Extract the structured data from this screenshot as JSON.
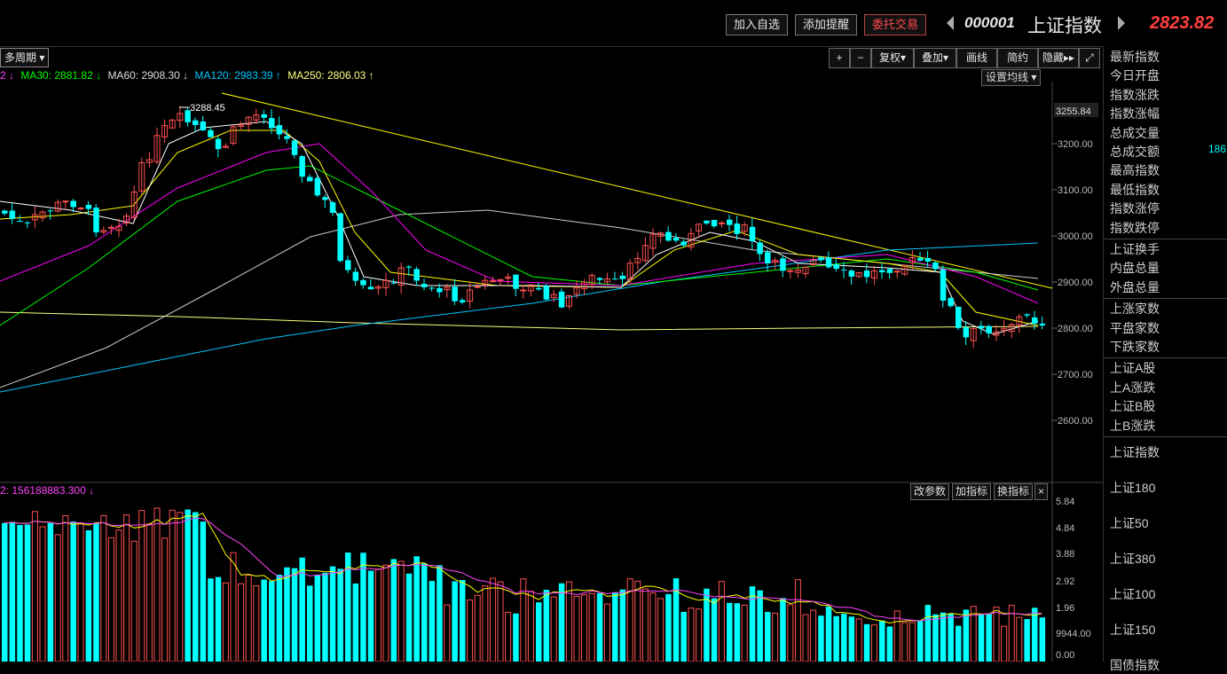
{
  "toolbar": {
    "add_watch": "加入自选",
    "add_alert": "添加提醒",
    "trade": "委托交易",
    "code": "000001",
    "name": "上证指数",
    "price": "2823.82"
  },
  "chart_toolbar": {
    "period": "多周期",
    "zoom_in": "+",
    "zoom_out": "−",
    "adjust": "复权",
    "overlay": "叠加",
    "draw": "画线",
    "brief": "简约",
    "hide": "隐藏",
    "expand": "⤢"
  },
  "ma_legend": {
    "ma_prefix": "2 ↓",
    "ma30": "MA30: 2881.82 ↓",
    "ma60": "MA60: 2908.30 ↓",
    "ma120": "MA120: 2983.39 ↑",
    "ma250": "MA250: 2806.03 ↑",
    "set_ma": "设置均线"
  },
  "price_chart": {
    "yticks": [
      "3200.00",
      "3100.00",
      "3000.00",
      "2900.00",
      "2800.00",
      "2700.00",
      "2600.00"
    ],
    "high_label": "3255.84",
    "peak_annotation": "3288.45"
  },
  "volume_panel": {
    "label": "2: 156188883.300 ↓",
    "change_params": "改参数",
    "add_indicator": "加指标",
    "switch_indicator": "换指标",
    "close": "×",
    "yticks": [
      "5.84",
      "4.84",
      "3.88",
      "2.92",
      "1.96",
      "9944.00",
      "0.00"
    ]
  },
  "right_panel": {
    "group1": [
      "最新指数",
      "今日开盘",
      "指数涨跌",
      "指数涨幅",
      "总成交量",
      "总成交额",
      "最高指数",
      "最低指数",
      "指数涨停",
      "指数跌停"
    ],
    "turnover_value": "186",
    "group2": [
      "上证换手",
      "内盘总量",
      "外盘总量"
    ],
    "group3": [
      "上涨家数",
      "平盘家数",
      "下跌家数"
    ],
    "group4": [
      "上证A股",
      "上A涨跌",
      "上证B股",
      "上B涨跌"
    ],
    "group5": [
      "上证指数",
      "上证180",
      "上证50",
      "上证380",
      "上证100",
      "上证150",
      "国债指数"
    ]
  },
  "colors": {
    "up": "#ff5050",
    "down": "#00ffff",
    "ma5": "#ffffff",
    "ma10": "#ffff00",
    "ma20": "#ff00ff",
    "ma30": "#00ff00",
    "ma60": "#cccccc",
    "ma120": "#00c8ff",
    "ma250": "#ffff80"
  }
}
